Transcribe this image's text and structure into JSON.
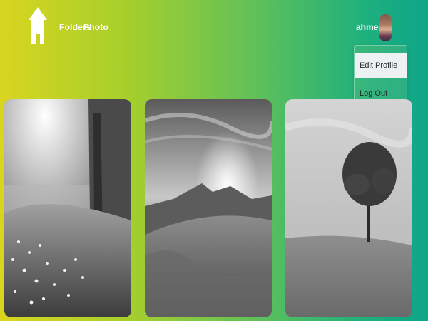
{
  "nav": {
    "home_icon": "house-icon",
    "links": [
      "Folders",
      "Photo"
    ]
  },
  "user": {
    "name": "ahmed",
    "caret": "▾",
    "avatar_icon": "user-avatar"
  },
  "dropdown": {
    "items": [
      "Edit Profile",
      "Log Out"
    ]
  },
  "photos": [
    {
      "subject": "forest-sunlight-flowers"
    },
    {
      "subject": "mountain-sunset-grass"
    },
    {
      "subject": "lone-tree-field"
    }
  ],
  "colors": {
    "gradient_start": "#d9d51f",
    "gradient_end": "#0ea58a",
    "nav_text": "#ffffff"
  }
}
